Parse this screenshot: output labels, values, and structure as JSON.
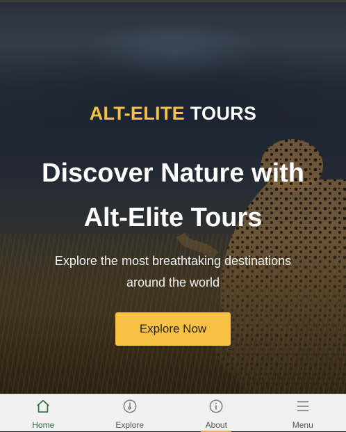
{
  "brand": {
    "part1": "ALT-ELITE",
    "part2": " TOURS"
  },
  "hero": {
    "headline_line1": "Discover Nature with",
    "headline_line2": "Alt-Elite Tours",
    "subtext": "Explore the most breathtaking destinations around the world",
    "cta_label": "Explore Now"
  },
  "nav": {
    "items": [
      {
        "label": "Home",
        "icon": "home-icon",
        "active": true
      },
      {
        "label": "Explore",
        "icon": "compass-icon",
        "active": false
      },
      {
        "label": "About",
        "icon": "info-icon",
        "active": false
      },
      {
        "label": "Menu",
        "icon": "menu-icon",
        "active": false
      }
    ]
  },
  "colors": {
    "accent": "#f7c243",
    "active_nav": "#2f6b3e",
    "nav_bg": "#f1f1f1"
  }
}
